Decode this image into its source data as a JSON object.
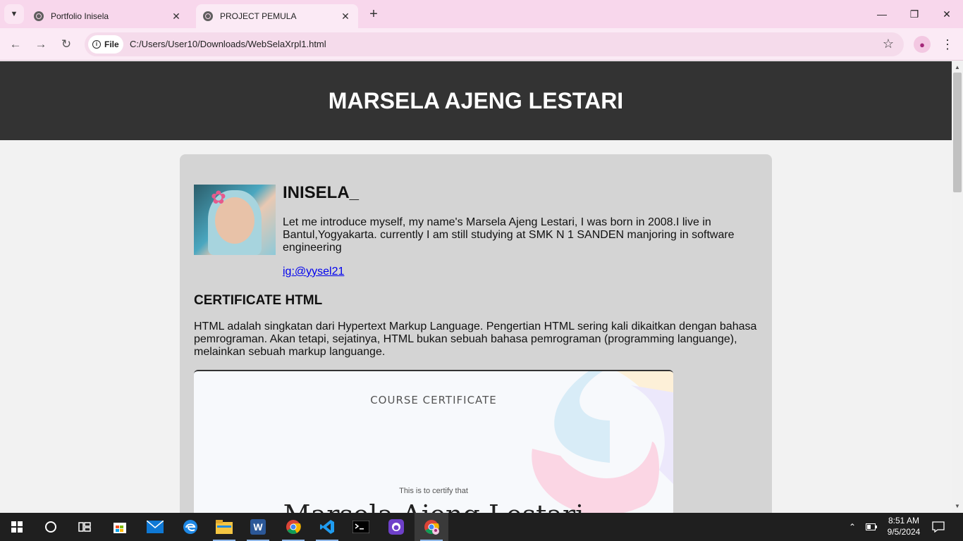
{
  "browser": {
    "tabs": [
      {
        "title": "Portfolio Inisela",
        "active": false
      },
      {
        "title": "PROJECT PEMULA",
        "active": true
      }
    ],
    "address": {
      "scheme_chip": "File",
      "url": "C:/Users/User10/Downloads/WebSelaXrpl1.html"
    }
  },
  "page": {
    "header_title": "MARSELA AJENG LESTARI",
    "profile": {
      "username": "INISELA_",
      "intro": "Let me introduce myself, my name's Marsela Ajeng Lestari, I was born in 2008.I live in Bantul,Yogyakarta. currently I am still studying at SMK N 1 SANDEN manjoring in software engineering",
      "instagram_link": "ig:@yysel21"
    },
    "certificate": {
      "heading": "CERTIFICATE HTML",
      "description": "HTML adalah singkatan dari Hypertext Markup Language. Pengertian HTML sering kali dikaitkan dengan bahasa pemrograman. Akan tetapi, sejatinya, HTML bukan sebuah bahasa pemrograman (programming languange), melainkan sebuah markup languange.",
      "image": {
        "label": "COURSE CERTIFICATE",
        "certify_text": "This is to certify that",
        "recipient": "Marsela Ajeng Lestari"
      }
    }
  },
  "taskbar": {
    "apps": [
      "start-icon",
      "cortana-icon",
      "task-view-icon",
      "store-icon",
      "mail-icon",
      "edge-icon",
      "file-explorer-icon",
      "word-icon",
      "chrome-icon",
      "vscode-icon",
      "terminal-icon",
      "github-desktop-icon",
      "chrome-profile-icon"
    ],
    "clock_time": "8:51 AM",
    "clock_date": "9/5/2024"
  },
  "colors": {
    "tabstrip": "#f8d7ec",
    "header_bg": "#333333",
    "card_bg": "#d4d4d4",
    "link": "#0000ee"
  }
}
